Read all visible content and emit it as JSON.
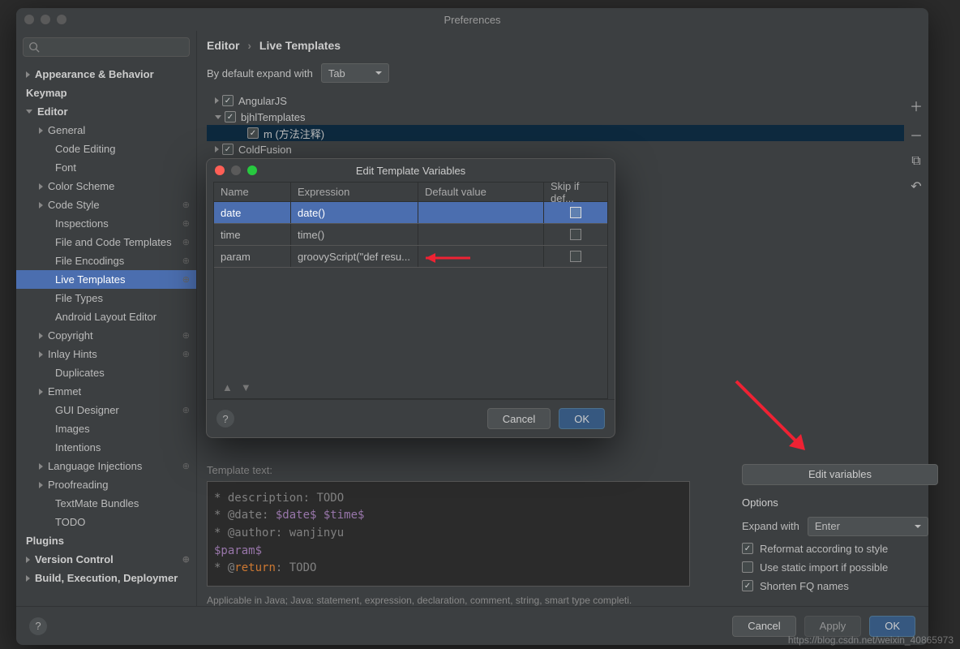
{
  "window": {
    "title": "Preferences",
    "breadcrumb": {
      "a": "Editor",
      "b": "Live Templates"
    },
    "default_expand_label": "By default expand with",
    "default_expand_value": "Tab"
  },
  "sidebar": {
    "items": [
      {
        "label": "Appearance & Behavior",
        "bold": true,
        "arrow": "right",
        "level": 0
      },
      {
        "label": "Keymap",
        "bold": true,
        "level": 0
      },
      {
        "label": "Editor",
        "bold": true,
        "arrow": "down",
        "level": 0
      },
      {
        "label": "General",
        "arrow": "right",
        "level": 1
      },
      {
        "label": "Code Editing",
        "level": 2
      },
      {
        "label": "Font",
        "level": 2
      },
      {
        "label": "Color Scheme",
        "arrow": "right",
        "level": 1
      },
      {
        "label": "Code Style",
        "arrow": "right",
        "level": 1,
        "badge": "⊕"
      },
      {
        "label": "Inspections",
        "level": 2,
        "badge": "⊕"
      },
      {
        "label": "File and Code Templates",
        "level": 2,
        "badge": "⊕"
      },
      {
        "label": "File Encodings",
        "level": 2,
        "badge": "⊕"
      },
      {
        "label": "Live Templates",
        "level": 2,
        "selected": true,
        "badge": "⊕"
      },
      {
        "label": "File Types",
        "level": 2
      },
      {
        "label": "Android Layout Editor",
        "level": 2
      },
      {
        "label": "Copyright",
        "arrow": "right",
        "level": 1,
        "badge": "⊕"
      },
      {
        "label": "Inlay Hints",
        "arrow": "right",
        "level": 1,
        "badge": "⊕"
      },
      {
        "label": "Duplicates",
        "level": 2
      },
      {
        "label": "Emmet",
        "arrow": "right",
        "level": 1
      },
      {
        "label": "GUI Designer",
        "level": 2,
        "badge": "⊕"
      },
      {
        "label": "Images",
        "level": 2
      },
      {
        "label": "Intentions",
        "level": 2
      },
      {
        "label": "Language Injections",
        "arrow": "right",
        "level": 1,
        "badge": "⊕"
      },
      {
        "label": "Proofreading",
        "arrow": "right",
        "level": 1
      },
      {
        "label": "TextMate Bundles",
        "level": 2
      },
      {
        "label": "TODO",
        "level": 2
      },
      {
        "label": "Plugins",
        "bold": true,
        "level": 0
      },
      {
        "label": "Version Control",
        "bold": true,
        "arrow": "right",
        "level": 0,
        "badge": "⊕"
      },
      {
        "label": "Build, Execution, Deploymer",
        "bold": true,
        "arrow": "right",
        "level": 0
      }
    ]
  },
  "template_tree": [
    {
      "label": "AngularJS",
      "check": true,
      "arrow": "right",
      "level": 0
    },
    {
      "label": "bjhlTemplates",
      "check": true,
      "arrow": "down",
      "level": 0
    },
    {
      "label": "m (方法注释)",
      "check": true,
      "level": 2,
      "selected": true
    },
    {
      "label": "ColdFusion",
      "check": true,
      "arrow": "right",
      "level": 0
    }
  ],
  "template_text_label": "Template text:",
  "template_code": {
    "l1a": " * description: ",
    "l1b": "TODO",
    "l2a": " * @date: ",
    "l2b": "$date$",
    "l2c": "$time$",
    "l3a": " * @author: wanjinyu",
    "l4a": "$param$",
    "l5a": " * @",
    "l5b": "return",
    "l5c": ": ",
    "l5d": "TODO"
  },
  "applicable_text": "Applicable in Java; Java: statement, expression, declaration, comment, string, smart type completi.",
  "edit_vars_btn": "Edit variables",
  "options": {
    "title": "Options",
    "expand_with_label": "Expand with",
    "expand_with_value": "Enter",
    "reformat": "Reformat according to style",
    "static_import": "Use static import if possible",
    "shorten": "Shorten FQ names"
  },
  "bottom": {
    "cancel": "Cancel",
    "apply": "Apply",
    "ok": "OK"
  },
  "modal": {
    "title": "Edit Template Variables",
    "headers": {
      "name": "Name",
      "expr": "Expression",
      "def": "Default value",
      "skip": "Skip if def..."
    },
    "rows": [
      {
        "name": "date",
        "expr": "date()",
        "def": "",
        "skip": false,
        "selected": true
      },
      {
        "name": "time",
        "expr": "time()",
        "def": "",
        "skip": false
      },
      {
        "name": "param",
        "expr": "groovyScript(\"def resu...",
        "def": "",
        "skip": false
      }
    ],
    "cancel": "Cancel",
    "ok": "OK"
  },
  "watermark": "https://blog.csdn.net/weixin_40865973"
}
